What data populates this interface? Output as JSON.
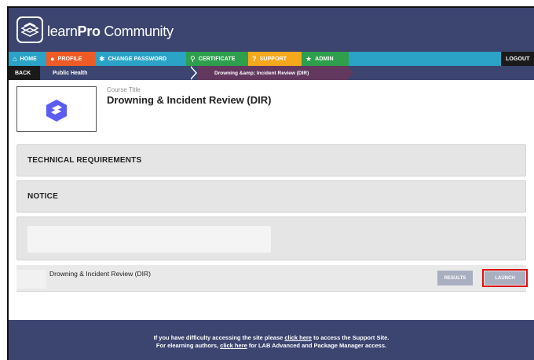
{
  "header": {
    "logo_prefix": "learn",
    "logo_bold": "Pro",
    "logo_suffix": " Community"
  },
  "nav": {
    "items": [
      {
        "label": "HOME",
        "icon": "home-icon"
      },
      {
        "label": "PROFILE",
        "icon": "user-icon"
      },
      {
        "label": "CHANGE PASSWORD",
        "icon": "asterisk-icon"
      },
      {
        "label": "CERTIFICATE",
        "icon": "award-icon"
      },
      {
        "label": "SUPPORT",
        "icon": "question-icon"
      },
      {
        "label": "ADMIN",
        "icon": "star-icon"
      }
    ],
    "logout": "LOGOUT"
  },
  "breadcrumb": {
    "back": "BACK",
    "parent": "Public Health",
    "current": "Drowning &amp; Incident Review (DIR)"
  },
  "course": {
    "label": "Course Title",
    "title": "Drowning & Incident Review (DIR)"
  },
  "panels": {
    "technical": "TECHNICAL REQUIREMENTS",
    "notice": "NOTICE"
  },
  "module": {
    "name": "Drowning & Incident Review (DIR)",
    "results_label": "RESULTS",
    "launch_label": "LAUNCH"
  },
  "footer": {
    "line1_pre": "If you have difficulty accessing the site please ",
    "line1_link": "click here",
    "line1_post": " to access the Support Site.",
    "line2_pre": "For elearning authors, ",
    "line2_link": "click here",
    "line2_post": " for LAB Advanced and Package Manager access."
  },
  "colors": {
    "header_bg": "#3c4570",
    "nav_bg": "#2aa3c7",
    "profile": "#ef5b25",
    "certificate": "#2e9f4d",
    "support": "#f5a81c",
    "current_crumb": "#63385e",
    "highlight": "#dd1111"
  }
}
